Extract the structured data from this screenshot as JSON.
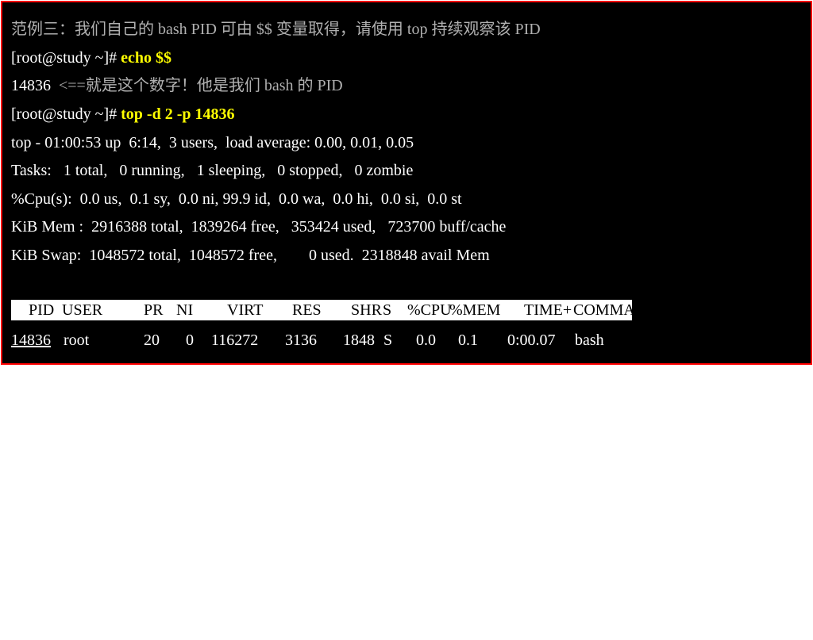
{
  "terminal": {
    "lines": {
      "intro": "范例三：我们自己的 bash PID 可由 $$ 变量取得，请使用 top 持续观察该 PID",
      "prompt1": "[root@study ~]# ",
      "cmd1": "echo $$",
      "pid_output": "14836",
      "pid_comment": "<==就是这个数字！他是我们 bash 的 PID",
      "prompt2": "[root@study ~]# ",
      "cmd2": "top -d 2 -p 14836",
      "uptime": "top - 01:00:53 up  6:14,  3 users,  load average: 0.00, 0.01, 0.05",
      "tasks": "Tasks:   1 total,   0 running,   1 sleeping,   0 stopped,   0 zombie",
      "cpu": "%Cpu(s):  0.0 us,  0.1 sy,  0.0 ni, 99.9 id,  0.0 wa,  0.0 hi,  0.0 si,  0.0 st",
      "mem": "KiB Mem :  2916388 total,  1839264 free,   353424 used,   723700 buff/cache",
      "swap": "KiB Swap:  1048572 total,  1048572 free,        0 used.  2318848 avail Mem"
    },
    "process_table": {
      "columns": [
        "PID",
        "USER",
        "PR",
        "NI",
        "VIRT",
        "RES",
        "SHR",
        "S",
        "%CPU",
        "%MEM",
        "TIME+",
        "COMMAND"
      ],
      "rows": [
        [
          "14836",
          "root",
          "20",
          "0",
          "116272",
          "3136",
          "1848",
          "S",
          "0.0",
          "0.1",
          "0:00.07",
          "bash"
        ]
      ]
    }
  },
  "colors": {
    "background": "#000000",
    "border": "#ff0000",
    "command": "#ffff00",
    "comment": "#b0b0b0",
    "header_bg": "#ffffff"
  }
}
